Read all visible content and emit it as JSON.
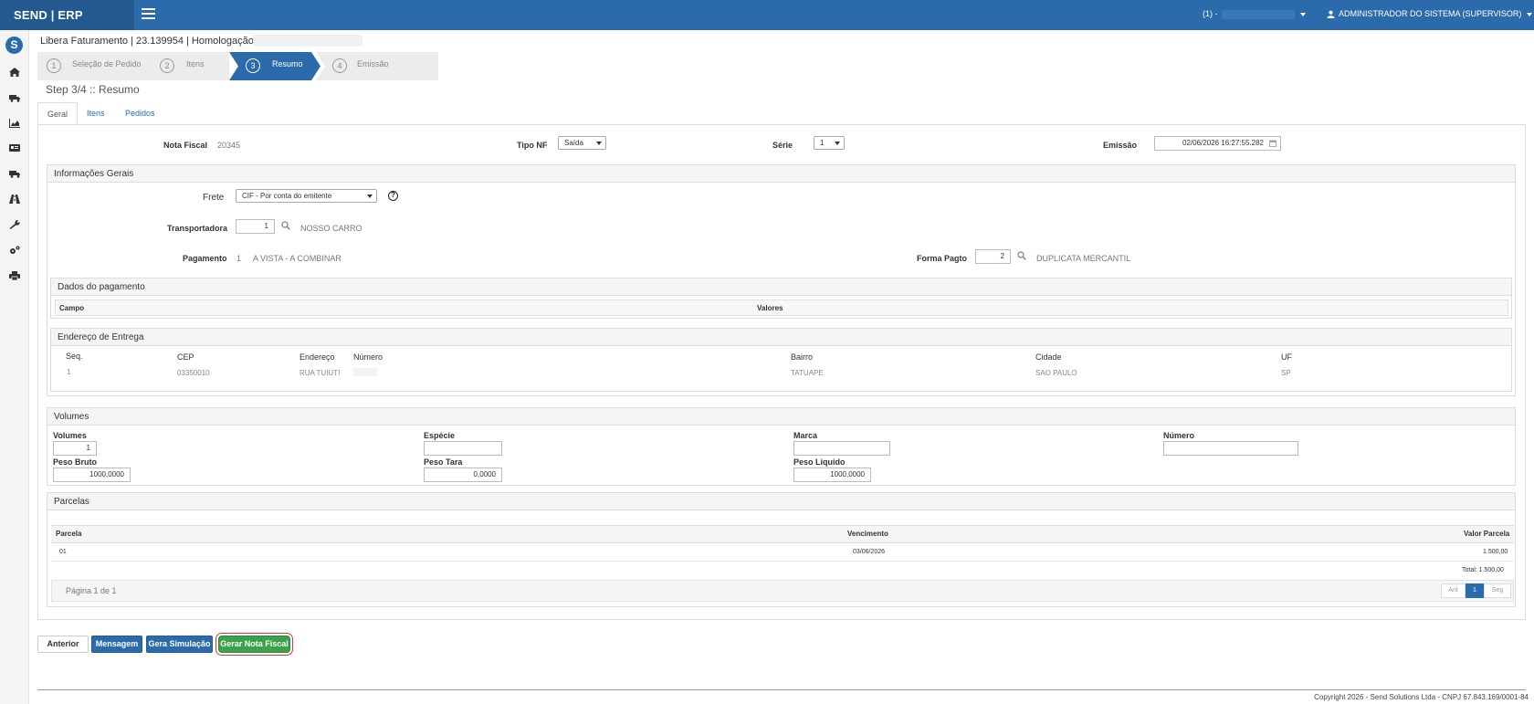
{
  "topbar": {
    "brand": "SEND | ERP",
    "company_label": "(1) -",
    "user_label": "ADMINISTRADOR DO SISTEMA (SUPERVISOR)"
  },
  "sidebar": {
    "logo": "S",
    "icons": [
      "home-icon",
      "truck-icon",
      "chart-icon",
      "card-icon",
      "truck-icon",
      "road-icon",
      "wrench-icon",
      "gears-icon",
      "print-icon"
    ]
  },
  "page": {
    "title": "Libera Faturamento | 23.139954 | Homologação |"
  },
  "wizard": {
    "steps": [
      {
        "num": "1",
        "label": "Seleção de Pedido"
      },
      {
        "num": "2",
        "label": "Itens"
      },
      {
        "num": "3",
        "label": "Resumo"
      },
      {
        "num": "4",
        "label": "Emissão"
      }
    ],
    "active_index": 2,
    "step_title": "Step 3/4 :: Resumo"
  },
  "tabs": [
    {
      "label": "Geral"
    },
    {
      "label": "Itens"
    },
    {
      "label": "Pedidos"
    }
  ],
  "header_fields": {
    "nota_fiscal_label": "Nota Fiscal",
    "nota_fiscal_value": "20345",
    "tipo_nf_label": "Tipo NF",
    "tipo_nf_value": "Saída",
    "serie_label": "Série",
    "serie_value": "1",
    "emissao_label": "Emissão",
    "emissao_value": "02/06/2026 16:27:55.282"
  },
  "info_gerais": {
    "title": "Informações Gerais",
    "frete_label": "Frete",
    "frete_value": "CIF - Por conta do emitente",
    "transportadora_label": "Transportadora",
    "transportadora_code": "1",
    "transportadora_name": "NOSSO CARRO",
    "pagamento_label": "Pagamento",
    "pagamento_code": "1",
    "pagamento_desc": "A VISTA - A COMBINAR",
    "forma_pagto_label": "Forma Pagto",
    "forma_pagto_code": "2",
    "forma_pagto_desc": "DUPLICATA MERCANTIL"
  },
  "dados_pagamento": {
    "title": "Dados do pagamento",
    "col_campo": "Campo",
    "col_valores": "Valores"
  },
  "endereco": {
    "title": "Endereço de Entrega",
    "headers": {
      "seq": "Seq.",
      "cep": "CEP",
      "endereco": "Endereço",
      "numero": "Número",
      "bairro": "Bairro",
      "cidade": "Cidade",
      "uf": "UF"
    },
    "row": {
      "seq": "1",
      "cep": "03350010",
      "endereco": "RUA TUIUTI",
      "numero": "",
      "bairro": "TATUAPE",
      "cidade": "SAO PAULO",
      "uf": "SP"
    }
  },
  "volumes": {
    "title": "Volumes",
    "volumes_label": "Volumes",
    "volumes_value": "1",
    "especie_label": "Espécie",
    "especie_value": "",
    "marca_label": "Marca",
    "marca_value": "",
    "numero_label": "Número",
    "numero_value": "",
    "peso_bruto_label": "Peso Bruto",
    "peso_bruto_value": "1000,0000",
    "peso_tara_label": "Peso Tara",
    "peso_tara_value": "0,0000",
    "peso_liquido_label": "Peso Liquido",
    "peso_liquido_value": "1000,0000"
  },
  "parcelas": {
    "title": "Parcelas",
    "col_parcela": "Parcela",
    "col_vencimento": "Vencimento",
    "col_valor": "Valor Parcela",
    "row": {
      "parcela": "01",
      "vencimento": "03/06/2026",
      "valor": "1.500,00"
    },
    "total": "Total: 1.500,00",
    "page_info": "Página 1 de 1",
    "pager": {
      "prev": "Ant",
      "current": "1",
      "next": "Seg"
    }
  },
  "actions": {
    "anterior": "Anterior",
    "mensagem": "Mensagem",
    "gera_simulacao": "Gera Simulação",
    "gerar_nota": "Gerar Nota Fiscal"
  },
  "footer": {
    "copyright": "Copyright 2026 - Send Solutions Ltda - CNPJ 67.843.169/0001-84"
  }
}
